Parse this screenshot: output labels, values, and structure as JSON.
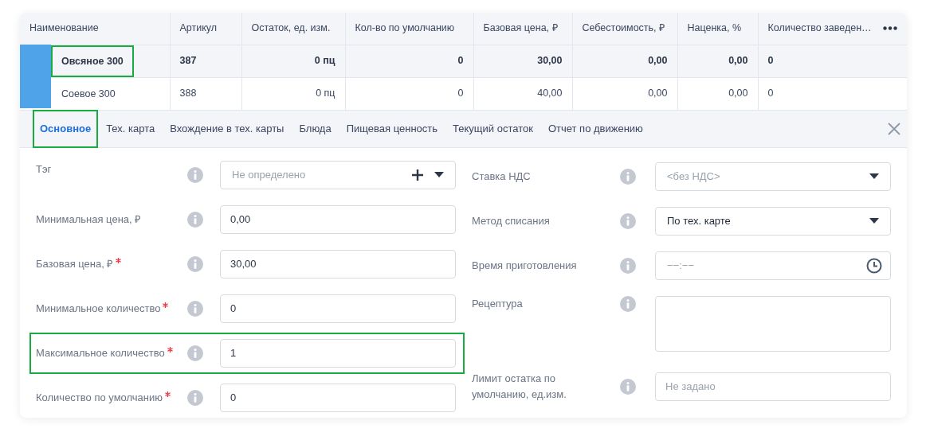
{
  "table": {
    "columns": [
      {
        "label": "Наименование",
        "kind": "text"
      },
      {
        "label": "Артикул",
        "kind": "text"
      },
      {
        "label": "Остаток, ед. изм.",
        "kind": "number"
      },
      {
        "label": "Кол-во по умолчанию",
        "kind": "number"
      },
      {
        "label": "Базовая цена, ₽",
        "kind": "number"
      },
      {
        "label": "Себестоимость, ₽",
        "kind": "number"
      },
      {
        "label": "Наценка, %",
        "kind": "number"
      },
      {
        "label": "Количество заведен…",
        "kind": "text"
      }
    ],
    "rows": [
      {
        "selected": true,
        "highlighted": true,
        "cells": [
          "Овсяное 300",
          "387",
          "0 пц",
          "0",
          "30,00",
          "0,00",
          "0,00",
          "0"
        ]
      },
      {
        "selected": false,
        "highlighted": false,
        "cells": [
          "Соевое 300",
          "388",
          "0 пц",
          "0",
          "40,00",
          "0,00",
          "0,00",
          "0"
        ]
      }
    ]
  },
  "tabs": [
    {
      "label": "Основное",
      "selected": true,
      "highlighted": true
    },
    {
      "label": "Тех. карта",
      "selected": false,
      "highlighted": false
    },
    {
      "label": "Вхождение в тех. карты",
      "selected": false,
      "highlighted": false
    },
    {
      "label": "Блюда",
      "selected": false,
      "highlighted": false
    },
    {
      "label": "Пищевая ценность",
      "selected": false,
      "highlighted": false
    },
    {
      "label": "Текущий остаток",
      "selected": false,
      "highlighted": false
    },
    {
      "label": "Отчет по движению",
      "selected": false,
      "highlighted": false
    }
  ],
  "form_left": [
    {
      "kind": "tag",
      "label": "Тэг",
      "required": false,
      "highlighted": false,
      "placeholder": "Не определено"
    },
    {
      "kind": "input",
      "label": "Минимальная цена, ₽",
      "required": false,
      "highlighted": false,
      "value": "0,00"
    },
    {
      "kind": "input",
      "label": "Базовая цена, ₽",
      "required": true,
      "highlighted": false,
      "value": "30,00"
    },
    {
      "kind": "input",
      "label": "Минимальное количество",
      "required": true,
      "highlighted": false,
      "value": "0"
    },
    {
      "kind": "input",
      "label": "Максимальное количество",
      "required": true,
      "highlighted": true,
      "value": "1"
    },
    {
      "kind": "input",
      "label": "Количество по умолчанию",
      "required": true,
      "highlighted": false,
      "value": "0"
    }
  ],
  "form_right": [
    {
      "kind": "select",
      "label": "Ставка НДС",
      "placeholder": "<без НДС>"
    },
    {
      "kind": "select",
      "label": "Метод списания",
      "value": "По тех. карте"
    },
    {
      "kind": "time",
      "label": "Время приготовления",
      "placeholder": "−−:−−"
    },
    {
      "kind": "textarea",
      "label": "Рецептура"
    },
    {
      "kind": "input",
      "label": "Лимит остатка по умолчанию, ед.изм.",
      "placeholder": "Не задано"
    }
  ]
}
